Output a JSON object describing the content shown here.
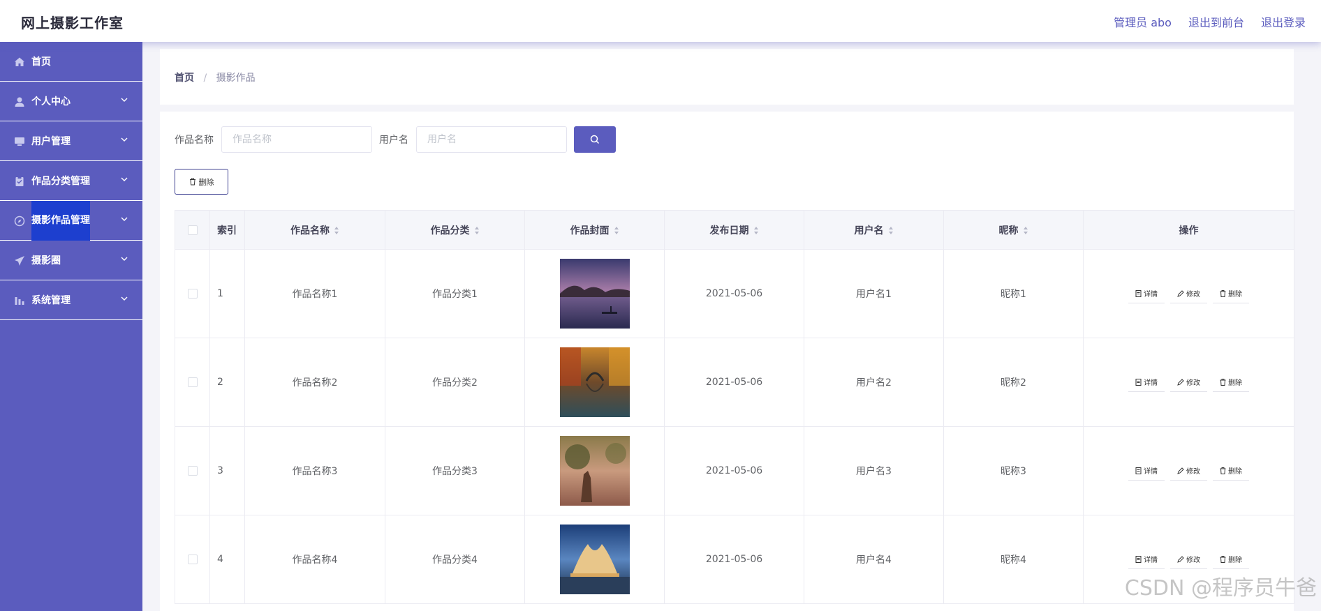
{
  "header": {
    "title": "网上摄影工作室",
    "links": [
      "管理员 abo",
      "退出到前台",
      "退出登录"
    ]
  },
  "sidebar": {
    "items": [
      {
        "label": "首页",
        "icon": "home-icon",
        "has_arrow": false
      },
      {
        "label": "个人中心",
        "icon": "user-icon",
        "has_arrow": true
      },
      {
        "label": "用户管理",
        "icon": "monitor-icon",
        "has_arrow": true
      },
      {
        "label": "作品分类管理",
        "icon": "clipboard-icon",
        "has_arrow": true
      },
      {
        "label": "摄影作品管理",
        "icon": "compass-icon",
        "has_arrow": true,
        "active": true
      },
      {
        "label": "摄影圈",
        "icon": "paper-plane-icon",
        "has_arrow": true
      },
      {
        "label": "系统管理",
        "icon": "bar-chart-icon",
        "has_arrow": true
      }
    ]
  },
  "breadcrumb": {
    "home": "首页",
    "separator": "/",
    "current": "摄影作品"
  },
  "search": {
    "work_name_label": "作品名称",
    "work_name_placeholder": "作品名称",
    "username_label": "用户名",
    "username_placeholder": "用户名"
  },
  "toolbar": {
    "delete_label": "删除"
  },
  "table": {
    "headers": [
      "索引",
      "作品名称",
      "作品分类",
      "作品封面",
      "发布日期",
      "用户名",
      "昵称",
      "操作"
    ],
    "rows": [
      {
        "index": "1",
        "name": "作品名称1",
        "category": "作品分类1",
        "date": "2021-05-06",
        "username": "用户名1",
        "nickname": "昵称1"
      },
      {
        "index": "2",
        "name": "作品名称2",
        "category": "作品分类2",
        "date": "2021-05-06",
        "username": "用户名2",
        "nickname": "昵称2"
      },
      {
        "index": "3",
        "name": "作品名称3",
        "category": "作品分类3",
        "date": "2021-05-06",
        "username": "用户名3",
        "nickname": "昵称3"
      },
      {
        "index": "4",
        "name": "作品名称4",
        "category": "作品分类4",
        "date": "2021-05-06",
        "username": "用户名4",
        "nickname": "昵称4"
      }
    ],
    "actions": [
      "详情",
      "修改",
      "删除"
    ]
  },
  "watermark": "CSDN @程序员牛爸",
  "colors": {
    "accent": "#5b5cbe",
    "active_item": "#1d3fcf"
  }
}
